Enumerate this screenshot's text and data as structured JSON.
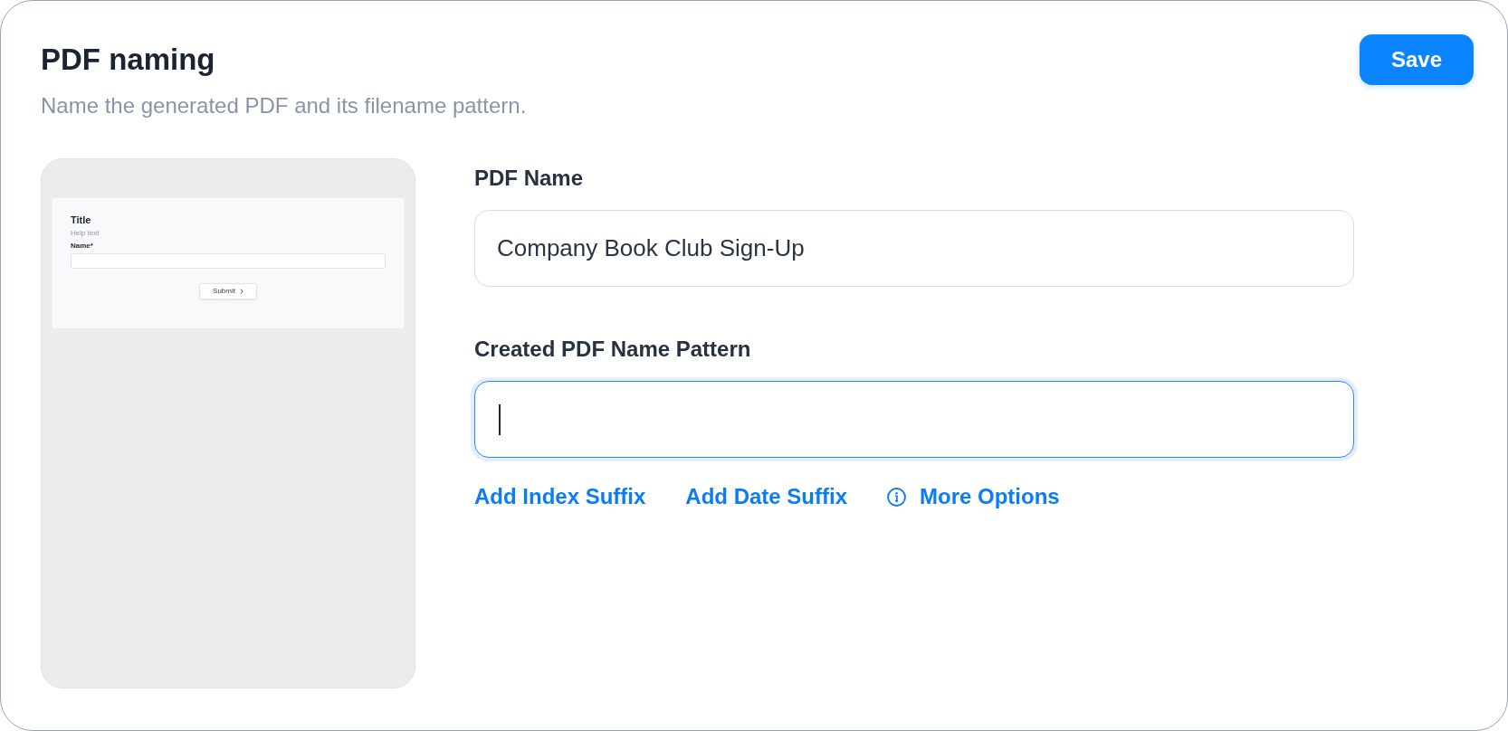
{
  "header": {
    "title": "PDF naming",
    "subtitle": "Name the generated PDF and its filename pattern.",
    "save_button": "Save"
  },
  "preview": {
    "title": "Title",
    "help_text": "Help text",
    "field_label": "Name*",
    "submit_button": "Submit"
  },
  "fields": [
    {
      "label": "PDF Name",
      "value": "Company Book Club Sign-Up",
      "focused": false
    },
    {
      "label": "Created PDF Name Pattern",
      "focused": true
    }
  ],
  "links": [
    {
      "label": "Add Index Suffix",
      "kind": "link"
    },
    {
      "label": "Add Date Suffix",
      "kind": "link"
    },
    {
      "label": "More Options",
      "kind": "info"
    }
  ]
}
